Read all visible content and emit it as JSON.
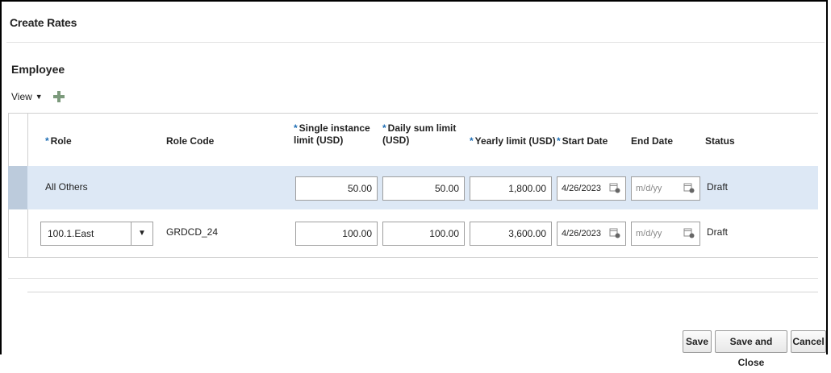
{
  "dialog": {
    "title": "Create Rates"
  },
  "section": {
    "title": "Employee",
    "view_label": "View"
  },
  "table": {
    "columns": {
      "role": "Role",
      "role_code": "Role Code",
      "single_line1": "Single instance",
      "single_line2": "limit (USD)",
      "daily_line1": "Daily sum limit",
      "daily_line2": "(USD)",
      "yearly": "Yearly limit (USD)",
      "start_date": "Start Date",
      "end_date": "End Date",
      "status": "Status"
    },
    "required_marker": "*",
    "rows": [
      {
        "role": "All Others",
        "role_code": "",
        "single": "50.00",
        "daily": "50.00",
        "yearly": "1,800.00",
        "start_date": "4/26/2023",
        "end_date_placeholder": "m/d/yy",
        "status": "Draft"
      },
      {
        "role": "100.1.East",
        "role_code": "GRDCD_24",
        "single": "100.00",
        "daily": "100.00",
        "yearly": "3,600.00",
        "start_date": "4/26/2023",
        "end_date_placeholder": "m/d/yy",
        "status": "Draft"
      }
    ]
  },
  "buttons": {
    "save": "Save",
    "save_and_close": "Save and Close",
    "cancel": "Cancel"
  },
  "icons": {
    "add": "plus-icon",
    "calendar": "calendar-icon",
    "dropdown": "chevron-down-icon"
  },
  "colors": {
    "required": "#1f6fb5",
    "selected_row": "#dde8f5",
    "add_icon": "#7c9a7c"
  }
}
